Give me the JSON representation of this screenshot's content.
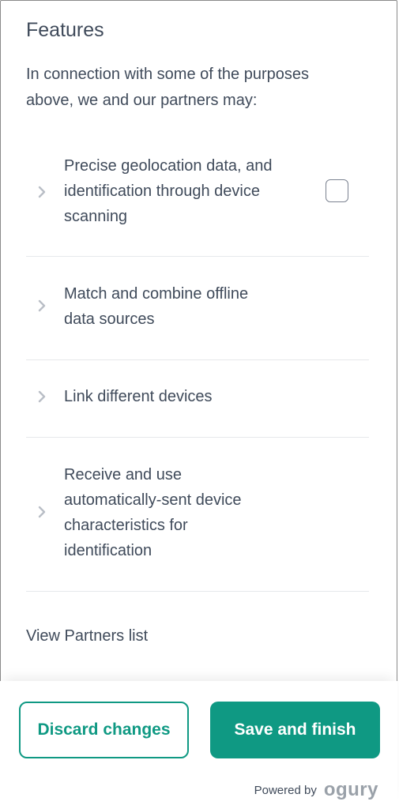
{
  "features": {
    "title": "Features",
    "description": "In connection with some of the purposes above, we and our partners may:",
    "items": [
      {
        "label": "Precise geolocation data, and identification through device scanning",
        "has_checkbox": true,
        "checked": false
      },
      {
        "label": "Match and combine offline data sources",
        "has_checkbox": false
      },
      {
        "label": "Link different devices",
        "has_checkbox": false
      },
      {
        "label": "Receive and use automatically-sent device characteristics for identification",
        "has_checkbox": false
      }
    ],
    "partners_link": "View Partners list"
  },
  "footer": {
    "discard_label": "Discard changes",
    "save_label": "Save and finish",
    "powered_by": "Powered by",
    "brand": "ogury"
  },
  "colors": {
    "accent": "#0f9983",
    "text": "#3f4a5a",
    "divider": "#e6e8eb",
    "logo": "#9aa1a9"
  },
  "icons": {
    "expand": "chevron-right-icon"
  }
}
